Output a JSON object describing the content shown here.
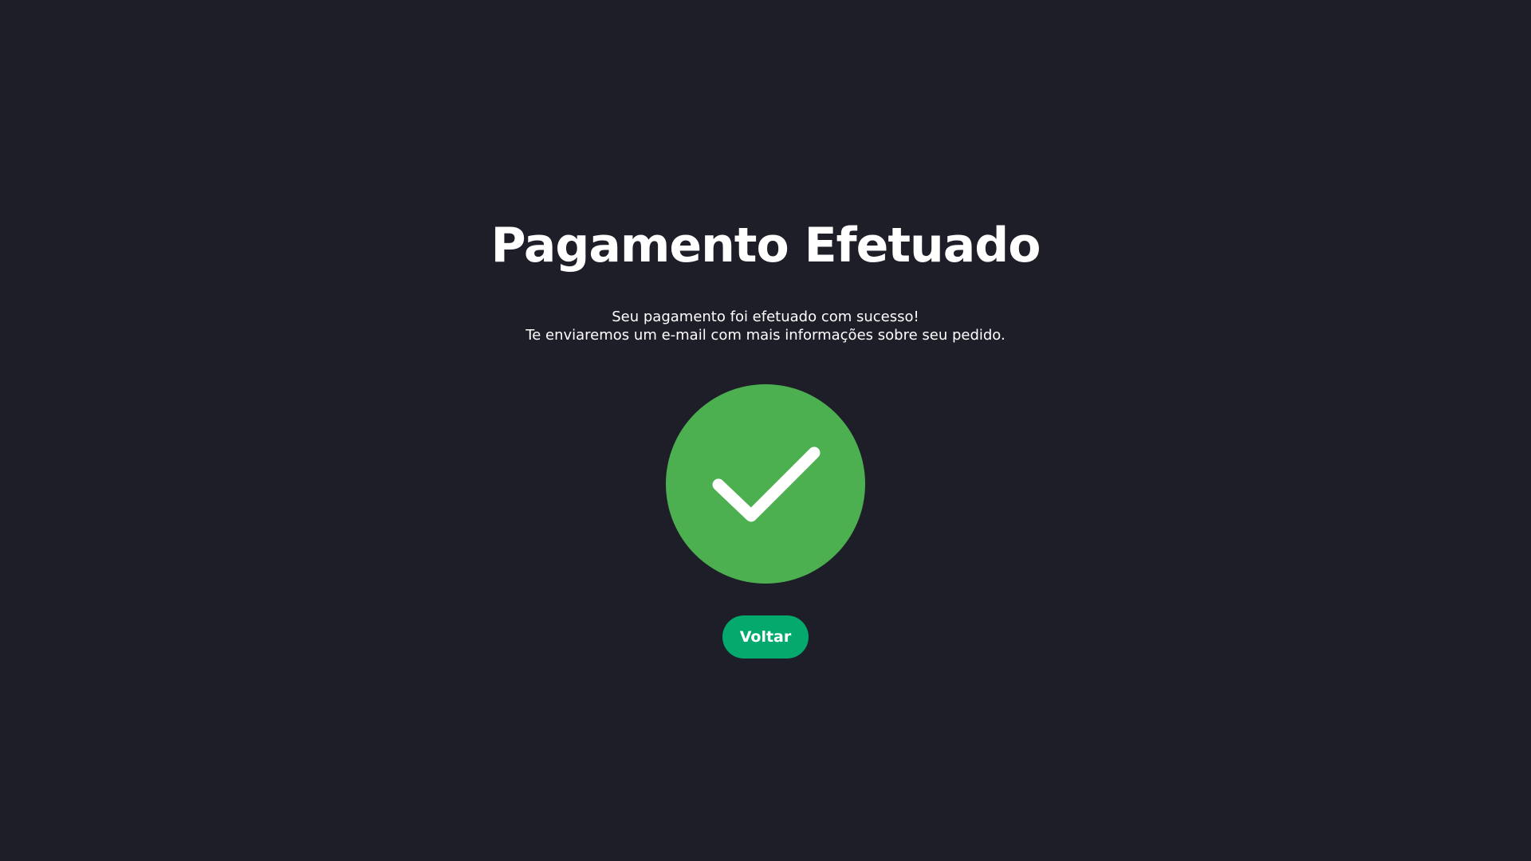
{
  "page": {
    "title": "Pagamento Efetuado",
    "message_line1": "Seu pagamento foi efetuado com sucesso!",
    "message_line2": "Te enviaremos um e-mail com mais informações sobre seu pedido.",
    "back_label": "Voltar"
  },
  "icons": {
    "status": "checkmark-icon"
  },
  "colors": {
    "background": "#1e1e29",
    "success": "#4caf50",
    "button": "#04aa6d",
    "text": "#ffffff"
  }
}
